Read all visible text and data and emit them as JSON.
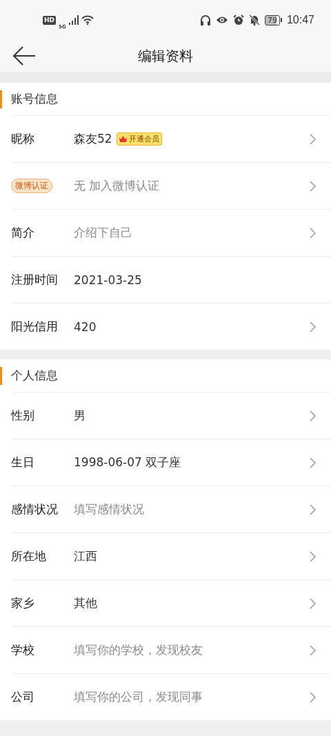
{
  "status_bar": {
    "hd": "HD",
    "network": "5G",
    "battery": "79",
    "time": "10:47"
  },
  "header": {
    "title": "编辑资料"
  },
  "sections": [
    {
      "title": "账号信息",
      "rows": [
        {
          "kind": "text",
          "label": "昵称",
          "value": "森友52",
          "muted": false,
          "badge": "开通会员",
          "arrow": true
        },
        {
          "kind": "badge",
          "label": "微博认证",
          "value": "无 加入微博认证",
          "muted": true,
          "arrow": true
        },
        {
          "kind": "text",
          "label": "简介",
          "value": "介绍下自己",
          "muted": true,
          "arrow": true
        },
        {
          "kind": "text",
          "label": "注册时间",
          "value": "2021-03-25",
          "muted": false,
          "arrow": false
        },
        {
          "kind": "text",
          "label": "阳光信用",
          "value": "420",
          "muted": false,
          "arrow": true
        }
      ]
    },
    {
      "title": "个人信息",
      "rows": [
        {
          "kind": "text",
          "label": "性别",
          "value": "男",
          "muted": false,
          "arrow": true
        },
        {
          "kind": "text",
          "label": "生日",
          "value": "1998-06-07 双子座",
          "muted": false,
          "arrow": true
        },
        {
          "kind": "text",
          "label": "感情状况",
          "value": "填写感情状况",
          "muted": true,
          "arrow": true
        },
        {
          "kind": "text",
          "label": "所在地",
          "value": "江西",
          "muted": false,
          "arrow": true
        },
        {
          "kind": "text",
          "label": "家乡",
          "value": "其他",
          "muted": false,
          "arrow": true
        },
        {
          "kind": "text",
          "label": "学校",
          "value": "填写你的学校，发现校友",
          "muted": true,
          "arrow": true
        },
        {
          "kind": "text",
          "label": "公司",
          "value": "填写你的公司，发现同事",
          "muted": true,
          "arrow": true
        }
      ]
    }
  ]
}
